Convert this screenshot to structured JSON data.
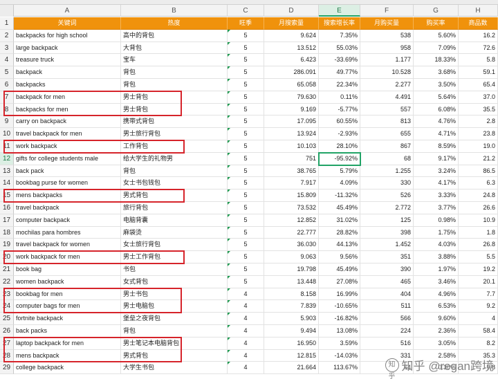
{
  "columns": [
    "A",
    "B",
    "C",
    "D",
    "E",
    "F",
    "G",
    "H"
  ],
  "active_column": "E",
  "header_row": {
    "row_number": "1",
    "cells": [
      "关键词",
      "热度",
      "旺季",
      "月搜索量",
      "搜索增长率",
      "月购买量",
      "购买率",
      "商品数"
    ]
  },
  "rows": [
    {
      "n": "2",
      "a": "backpacks for high school",
      "b": "高中的背包",
      "c": "5",
      "d": "9.624",
      "e": "7.35%",
      "f": "538",
      "g": "5.60%",
      "h": "16.2"
    },
    {
      "n": "3",
      "a": "large backpack",
      "b": "大背包",
      "c": "5",
      "d": "13.512",
      "e": "55.03%",
      "f": "958",
      "g": "7.09%",
      "h": "72.6"
    },
    {
      "n": "4",
      "a": "treasure truck",
      "b": "宝车",
      "c": "5",
      "d": "6.423",
      "e": "-33.69%",
      "f": "1.177",
      "g": "18.33%",
      "h": "5.8"
    },
    {
      "n": "5",
      "a": "backpack",
      "b": "背包",
      "c": "5",
      "d": "286.091",
      "e": "49.77%",
      "f": "10.528",
      "g": "3.68%",
      "h": "59.1"
    },
    {
      "n": "6",
      "a": "backpacks",
      "b": "背包",
      "c": "5",
      "d": "65.058",
      "e": "22.34%",
      "f": "2.277",
      "g": "3.50%",
      "h": "65.4"
    },
    {
      "n": "7",
      "a": "backpack for men",
      "b": "男士背包",
      "c": "5",
      "d": "79.630",
      "e": "0.11%",
      "f": "4.491",
      "g": "5.64%",
      "h": "37.0"
    },
    {
      "n": "8",
      "a": "backpacks for men",
      "b": "男士背包",
      "c": "5",
      "d": "9.169",
      "e": "-5.77%",
      "f": "557",
      "g": "6.08%",
      "h": "35.5"
    },
    {
      "n": "9",
      "a": "carry on backpack",
      "b": "携带式背包",
      "c": "5",
      "d": "17.095",
      "e": "60.55%",
      "f": "813",
      "g": "4.76%",
      "h": "2.8"
    },
    {
      "n": "10",
      "a": "travel backpack for men",
      "b": "男士旅行背包",
      "c": "5",
      "d": "13.924",
      "e": "-2.93%",
      "f": "655",
      "g": "4.71%",
      "h": "23.8"
    },
    {
      "n": "11",
      "a": "work backpack",
      "b": "工作背包",
      "c": "5",
      "d": "10.103",
      "e": "28.10%",
      "f": "867",
      "g": "8.59%",
      "h": "19.0"
    },
    {
      "n": "12",
      "a": "gifts for college students male",
      "b": "给大学生的礼物男",
      "c": "5",
      "d": "751",
      "e": "-95.92%",
      "f": "68",
      "g": "9.17%",
      "h": "21.2"
    },
    {
      "n": "13",
      "a": "back pack",
      "b": "背包",
      "c": "5",
      "d": "38.765",
      "e": "5.79%",
      "f": "1.255",
      "g": "3.24%",
      "h": "86.5"
    },
    {
      "n": "14",
      "a": "bookbag purse for women",
      "b": "女士书包钱包",
      "c": "5",
      "d": "7.917",
      "e": "4.09%",
      "f": "330",
      "g": "4.17%",
      "h": "6.3"
    },
    {
      "n": "15",
      "a": "mens backpacks",
      "b": "男式背包",
      "c": "5",
      "d": "15.809",
      "e": "-11.32%",
      "f": "526",
      "g": "3.33%",
      "h": "24.8"
    },
    {
      "n": "16",
      "a": "travel backpack",
      "b": "旅行背包",
      "c": "5",
      "d": "73.532",
      "e": "45.49%",
      "f": "2.772",
      "g": "3.77%",
      "h": "26.6"
    },
    {
      "n": "17",
      "a": "computer backpack",
      "b": "电脑背囊",
      "c": "5",
      "d": "12.852",
      "e": "31.02%",
      "f": "125",
      "g": "0.98%",
      "h": "10.9"
    },
    {
      "n": "18",
      "a": "mochilas para hombres",
      "b": "麻袋烫",
      "c": "5",
      "d": "22.777",
      "e": "28.82%",
      "f": "398",
      "g": "1.75%",
      "h": "1.8"
    },
    {
      "n": "19",
      "a": "travel backpack for women",
      "b": "女士旅行背包",
      "c": "5",
      "d": "36.030",
      "e": "44.13%",
      "f": "1.452",
      "g": "4.03%",
      "h": "26.8"
    },
    {
      "n": "20",
      "a": "work backpack for men",
      "b": "男士工作背包",
      "c": "5",
      "d": "9.063",
      "e": "9.56%",
      "f": "351",
      "g": "3.88%",
      "h": "5.5"
    },
    {
      "n": "21",
      "a": "book bag",
      "b": "书包",
      "c": "5",
      "d": "19.798",
      "e": "45.49%",
      "f": "390",
      "g": "1.97%",
      "h": "19.2"
    },
    {
      "n": "22",
      "a": "women backpack",
      "b": "女式背包",
      "c": "5",
      "d": "13.448",
      "e": "27.08%",
      "f": "465",
      "g": "3.46%",
      "h": "20.1"
    },
    {
      "n": "23",
      "a": "bookbag for men",
      "b": "男士书包",
      "c": "4",
      "d": "8.158",
      "e": "16.99%",
      "f": "404",
      "g": "4.96%",
      "h": "7.7"
    },
    {
      "n": "24",
      "a": "computer bags for men",
      "b": "男士电脑包",
      "c": "4",
      "d": "7.839",
      "e": "-10.65%",
      "f": "511",
      "g": "6.53%",
      "h": "9.2"
    },
    {
      "n": "25",
      "a": "fortnite backpack",
      "b": "堡垒之夜背包",
      "c": "4",
      "d": "5.903",
      "e": "-16.82%",
      "f": "566",
      "g": "9.60%",
      "h": "4"
    },
    {
      "n": "26",
      "a": "back packs",
      "b": "背包",
      "c": "4",
      "d": "9.494",
      "e": "13.08%",
      "f": "224",
      "g": "2.36%",
      "h": "58.4"
    },
    {
      "n": "27",
      "a": "laptop backpack for men",
      "b": "男士笔记本电脑背包",
      "c": "4",
      "d": "16.950",
      "e": "3.59%",
      "f": "516",
      "g": "3.05%",
      "h": "8.2"
    },
    {
      "n": "28",
      "a": "mens backpack",
      "b": "男式背包",
      "c": "4",
      "d": "12.815",
      "e": "-14.03%",
      "f": "331",
      "g": "2.58%",
      "h": "35.3"
    },
    {
      "n": "29",
      "a": "college backpack",
      "b": "大学生书包",
      "c": "4",
      "d": "21.664",
      "e": "113.67%",
      "f": "64",
      "g": "0.30%",
      "h": "9.8"
    }
  ],
  "active_row": "12",
  "highlighted_rows": [
    "7-8",
    "11",
    "15",
    "20",
    "23-24",
    "27-28"
  ],
  "colors": {
    "header_orange": "#f0920c",
    "highlight_red": "#d6232a",
    "selection_green": "#21a366"
  },
  "watermark": {
    "logo": "知乎",
    "text": "知乎 @regan跨境"
  }
}
